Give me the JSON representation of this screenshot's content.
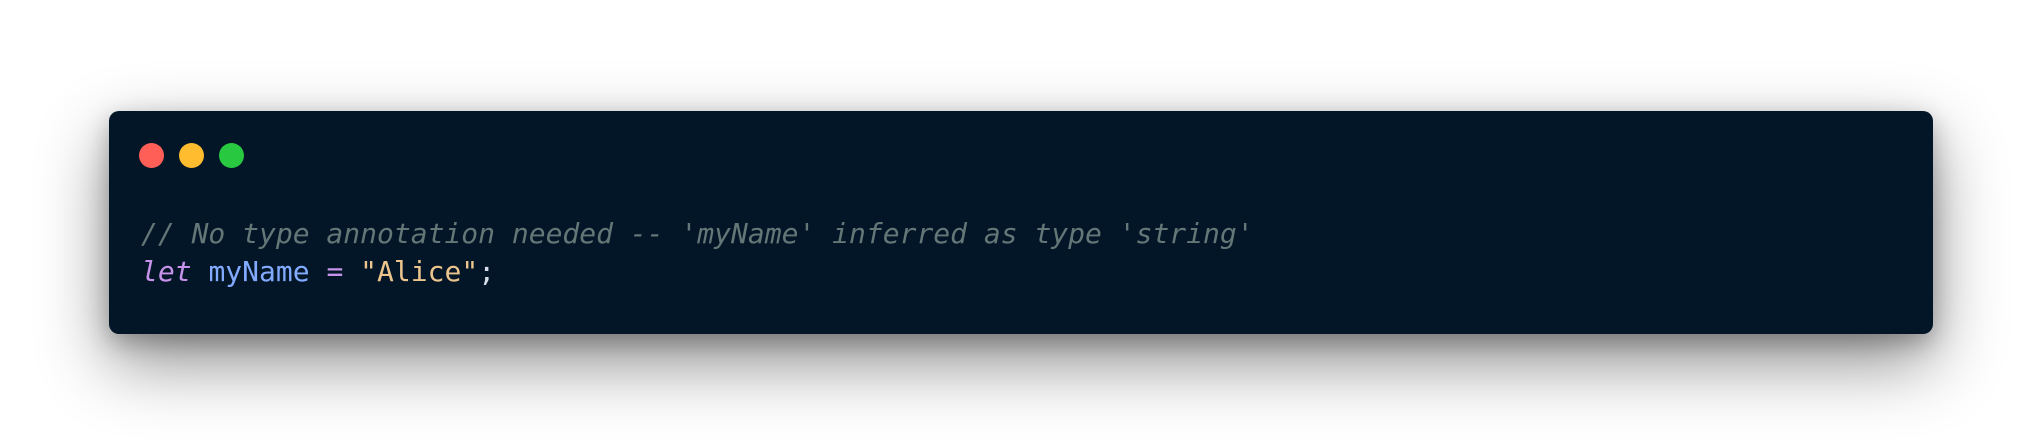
{
  "window_controls": {
    "close_color": "#ff5f57",
    "minimize_color": "#febc2e",
    "zoom_color": "#28c840"
  },
  "code": {
    "lines": [
      {
        "tokens": [
          {
            "type": "comment",
            "text": "// No type annotation needed -- 'myName' inferred as type 'string'"
          }
        ]
      },
      {
        "tokens": [
          {
            "type": "keyword",
            "text": "let"
          },
          {
            "type": "space",
            "text": " "
          },
          {
            "type": "identifier",
            "text": "myName"
          },
          {
            "type": "space",
            "text": " "
          },
          {
            "type": "operator",
            "text": "="
          },
          {
            "type": "space",
            "text": " "
          },
          {
            "type": "string",
            "text": "\"Alice\""
          },
          {
            "type": "punctuation",
            "text": ";"
          }
        ]
      }
    ]
  },
  "colors": {
    "background": "#021627",
    "comment": "#637777",
    "keyword": "#c792ea",
    "identifier": "#82aaff",
    "string": "#ecc48d",
    "punctuation": "#d6deeb"
  }
}
